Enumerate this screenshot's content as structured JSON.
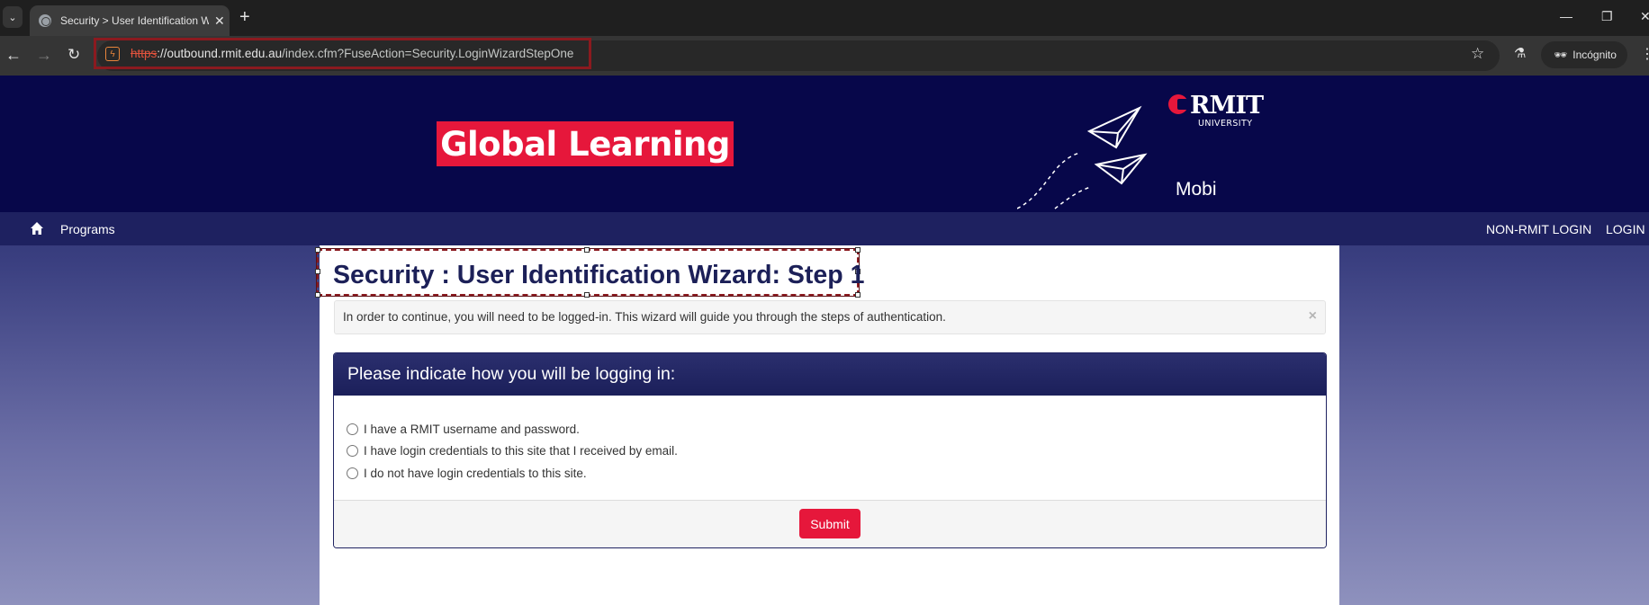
{
  "browser": {
    "tab_title": "Security > User Identification W",
    "new_tab_label": "+",
    "url_scheme": "https",
    "url_host": "://outbound.rmit.edu.au",
    "url_path": "/index.cfm?FuseAction=Security.LoginWizardStepOne",
    "profile_label": "Incógnito",
    "icons": [
      "tab-list-icon",
      "globe-icon",
      "close-icon",
      "back-icon",
      "forward-icon",
      "reload-icon",
      "site-info-icon",
      "star-icon",
      "lab-icon",
      "incognito-icon",
      "kebab-menu-icon",
      "minimize-icon",
      "restore-icon",
      "window-close-icon"
    ]
  },
  "banner": {
    "logo_text": "Global Learning",
    "university_name": "RMIT",
    "university_sub": "UNIVERSITY",
    "tagline": "Mobi",
    "colors": {
      "banner_bg": "#07074a",
      "brand_red": "#e6173b"
    }
  },
  "nav": {
    "home_icon": "home-icon",
    "programs_label": "Programs",
    "non_rmit_login_label": "NON-RMIT LOGIN",
    "login_label": "LOGIN"
  },
  "main": {
    "title": "Security : User Identification Wizard: Step 1",
    "alert_text": "In order to continue, you will need to be logged-in. This wizard will guide you through the steps of authentication.",
    "alert_close": "×",
    "card_heading": "Please indicate how you will be logging in:",
    "options": [
      {
        "label": "I have a RMIT username and password."
      },
      {
        "label": "I have login credentials to this site that I received by email."
      },
      {
        "label": "I do not have login credentials to this site."
      }
    ],
    "submit_label": "Submit"
  }
}
